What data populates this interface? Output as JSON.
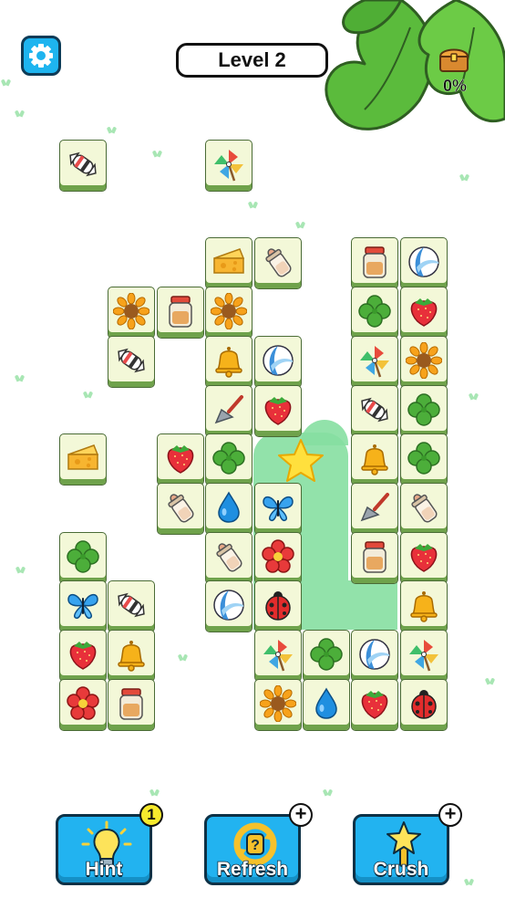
{
  "header": {
    "level_label": "Level 2"
  },
  "chest": {
    "progress_text": "0%"
  },
  "tiles": [
    {
      "col": 0,
      "row": 0,
      "icon": "candy-icon"
    },
    {
      "col": 3,
      "row": 0,
      "icon": "pinwheel-icon"
    },
    {
      "col": 3,
      "row": 2,
      "icon": "cheese-icon"
    },
    {
      "col": 4,
      "row": 2,
      "icon": "baby-bottle-icon"
    },
    {
      "col": 6,
      "row": 2,
      "icon": "jar-icon"
    },
    {
      "col": 7,
      "row": 2,
      "icon": "beach-ball-icon"
    },
    {
      "col": 1,
      "row": 3,
      "icon": "sunflower-icon"
    },
    {
      "col": 2,
      "row": 3,
      "icon": "jar-icon"
    },
    {
      "col": 3,
      "row": 3,
      "icon": "sunflower-icon"
    },
    {
      "col": 6,
      "row": 3,
      "icon": "clover-icon"
    },
    {
      "col": 7,
      "row": 3,
      "icon": "strawberry-icon"
    },
    {
      "col": 1,
      "row": 4,
      "icon": "candy-icon"
    },
    {
      "col": 3,
      "row": 4,
      "icon": "bell-icon"
    },
    {
      "col": 4,
      "row": 4,
      "icon": "beach-ball-icon"
    },
    {
      "col": 6,
      "row": 4,
      "icon": "pinwheel-icon"
    },
    {
      "col": 7,
      "row": 4,
      "icon": "sunflower-icon"
    },
    {
      "col": 3,
      "row": 5,
      "icon": "spatula-icon"
    },
    {
      "col": 4,
      "row": 5,
      "icon": "strawberry-icon"
    },
    {
      "col": 6,
      "row": 5,
      "icon": "candy-icon"
    },
    {
      "col": 7,
      "row": 5,
      "icon": "clover-icon"
    },
    {
      "col": 0,
      "row": 6,
      "icon": "cheese-icon"
    },
    {
      "col": 2,
      "row": 6,
      "icon": "strawberry-icon"
    },
    {
      "col": 3,
      "row": 6,
      "icon": "clover-icon"
    },
    {
      "col": 6,
      "row": 6,
      "icon": "bell-icon"
    },
    {
      "col": 7,
      "row": 6,
      "icon": "clover-icon"
    },
    {
      "col": 2,
      "row": 7,
      "icon": "baby-bottle-icon"
    },
    {
      "col": 3,
      "row": 7,
      "icon": "water-drop-icon"
    },
    {
      "col": 4,
      "row": 7,
      "icon": "butterfly-icon"
    },
    {
      "col": 6,
      "row": 7,
      "icon": "spatula-icon"
    },
    {
      "col": 7,
      "row": 7,
      "icon": "baby-bottle-icon"
    },
    {
      "col": 0,
      "row": 8,
      "icon": "clover-icon"
    },
    {
      "col": 3,
      "row": 8,
      "icon": "baby-bottle-icon"
    },
    {
      "col": 4,
      "row": 8,
      "icon": "flower-icon"
    },
    {
      "col": 6,
      "row": 8,
      "icon": "jar-icon"
    },
    {
      "col": 7,
      "row": 8,
      "icon": "strawberry-icon"
    },
    {
      "col": 0,
      "row": 9,
      "icon": "butterfly-icon"
    },
    {
      "col": 1,
      "row": 9,
      "icon": "candy-icon"
    },
    {
      "col": 3,
      "row": 9,
      "icon": "beach-ball-icon"
    },
    {
      "col": 4,
      "row": 9,
      "icon": "ladybug-icon"
    },
    {
      "col": 7,
      "row": 9,
      "icon": "bell-icon"
    },
    {
      "col": 0,
      "row": 10,
      "icon": "strawberry-icon"
    },
    {
      "col": 1,
      "row": 10,
      "icon": "bell-icon"
    },
    {
      "col": 4,
      "row": 10,
      "icon": "pinwheel-icon"
    },
    {
      "col": 5,
      "row": 10,
      "icon": "clover-icon"
    },
    {
      "col": 6,
      "row": 10,
      "icon": "beach-ball-icon"
    },
    {
      "col": 7,
      "row": 10,
      "icon": "pinwheel-icon"
    },
    {
      "col": 0,
      "row": 11,
      "icon": "flower-icon"
    },
    {
      "col": 1,
      "row": 11,
      "icon": "jar-icon"
    },
    {
      "col": 4,
      "row": 11,
      "icon": "sunflower-icon"
    },
    {
      "col": 5,
      "row": 11,
      "icon": "water-drop-icon"
    },
    {
      "col": 6,
      "row": 11,
      "icon": "strawberry-icon"
    },
    {
      "col": 7,
      "row": 11,
      "icon": "ladybug-icon"
    }
  ],
  "powerups": {
    "hint": {
      "label": "Hint",
      "count": "1"
    },
    "refresh": {
      "label": "Refresh",
      "badge": "+"
    },
    "crush": {
      "label": "Crush",
      "badge": "+"
    }
  }
}
